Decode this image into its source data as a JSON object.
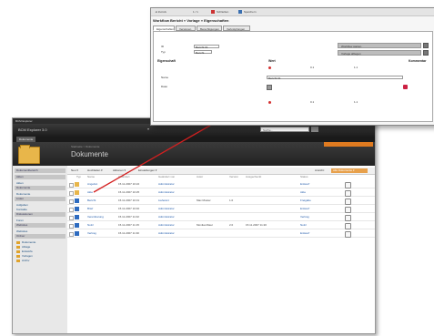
{
  "back": {
    "window_title": "BCM Explorer",
    "brand": "BCM Explorer 3.0",
    "search_value": "Suche...",
    "top_tab": "Dokumente",
    "breadcrumb": "Startseite > Dokumente",
    "page_title": "Dokumente",
    "sidebar": [
      {
        "type": "header",
        "label": "Dokumentbereich"
      },
      {
        "type": "header",
        "label": "Akten"
      },
      {
        "type": "item",
        "label": "Akten"
      },
      {
        "type": "header",
        "label": "Dokumente"
      },
      {
        "type": "item",
        "label": "Dokumente"
      },
      {
        "type": "header",
        "label": "Listen"
      },
      {
        "type": "item",
        "label": "Aufgaben"
      },
      {
        "type": "item",
        "label": "Kontakte"
      },
      {
        "type": "header",
        "label": "Diskussionen"
      },
      {
        "type": "item",
        "label": "Foren"
      },
      {
        "type": "header",
        "label": "Websites"
      },
      {
        "type": "item",
        "label": "Websites"
      },
      {
        "type": "header",
        "label": "Ordner"
      },
      {
        "type": "folder",
        "label": "Dokumente"
      },
      {
        "type": "folder",
        "label": "Ablage"
      },
      {
        "type": "folder",
        "label": "Entwürfe"
      },
      {
        "type": "folder",
        "label": "Vorlagen"
      },
      {
        "type": "folder",
        "label": "Archiv"
      }
    ],
    "toolbar": {
      "neu": "Neu ▾",
      "hochladen": "Hochladen ▾",
      "aktionen": "Aktionen ▾",
      "einstellungen": "Einstellungen ▾",
      "ansicht_label": "Ansicht:",
      "ansicht_value": "Alle Dokumente ▾"
    },
    "columns": [
      "Typ",
      "Name",
      "Geändert",
      "Geändert von",
      "Autor",
      "Version",
      "Ausgecheckt",
      "Status"
    ],
    "rows": [
      {
        "name": "Angebot",
        "date": "15.11.2007 10:22",
        "by": "Administrator",
        "author": "",
        "version": "",
        "out": "",
        "status": "Entwurf"
      },
      {
        "name": "Akte",
        "date": "15.11.2007 10:25",
        "by": "Administrator",
        "author": "",
        "version": "",
        "out": "",
        "status": "Akte"
      },
      {
        "name": "Bericht",
        "date": "15.11.2007 10:31",
        "by": "Lieferant",
        "author": "Max Muster",
        "version": "1.0",
        "out": "",
        "status": "Freigabe"
      },
      {
        "name": "Brief",
        "date": "15.11.2007 10:40",
        "by": "Administrator",
        "author": "",
        "version": "",
        "out": "",
        "status": "Entwurf"
      },
      {
        "name": "Vereinbarung",
        "date": "15.11.2007 11:02",
        "by": "Administrator",
        "author": "",
        "version": "",
        "out": "",
        "status": "Vertrag"
      },
      {
        "name": "Notiz",
        "date": "15.11.2007 11:15",
        "by": "Administrator",
        "author": "Monika Maier",
        "version": "2.0",
        "out": "15.11.2007 11:20",
        "status": "Notiz"
      },
      {
        "name": "Vertrag",
        "date": "15.11.2007 11:30",
        "by": "Administrator",
        "author": "",
        "version": "",
        "out": "",
        "status": "Entwurf"
      }
    ]
  },
  "front": {
    "topbar": {
      "back": "◄ Zurück",
      "page": "1 / 1",
      "close": "Schließen",
      "save": "Speichern"
    },
    "breadcrumb": "Workflow Bericht » Vorlage » Eigenschaften",
    "tabs": [
      "Eigenschaften",
      "Versionen",
      "Berechtigungen",
      "Verknüpfungen"
    ],
    "fields": [
      {
        "label": "ID",
        "value": "Bericht 01"
      },
      {
        "label": "Typ",
        "value": "Bericht"
      }
    ],
    "right_buttons": [
      "Workflow starten",
      "Vorlage ablegen"
    ],
    "prop_headers": {
      "eigenschaft": "Eigenschaft",
      "wert": "Wert",
      "kommentar": "Kommentar"
    },
    "rows": [
      {
        "label": "",
        "v1": "0.1",
        "v2": "1.1"
      },
      {
        "label": "Name",
        "v1": "Bericht 01",
        "v2": ""
      },
      {
        "label": "Datei",
        "v1": "",
        "v2": ""
      },
      {
        "label": "",
        "v1": "0.1",
        "v2": "1.1"
      }
    ]
  },
  "colors": {
    "accent": "#d42020",
    "orange": "#e07b20",
    "folder": "#e8b64a",
    "dark_header": "#1c1c1c"
  }
}
